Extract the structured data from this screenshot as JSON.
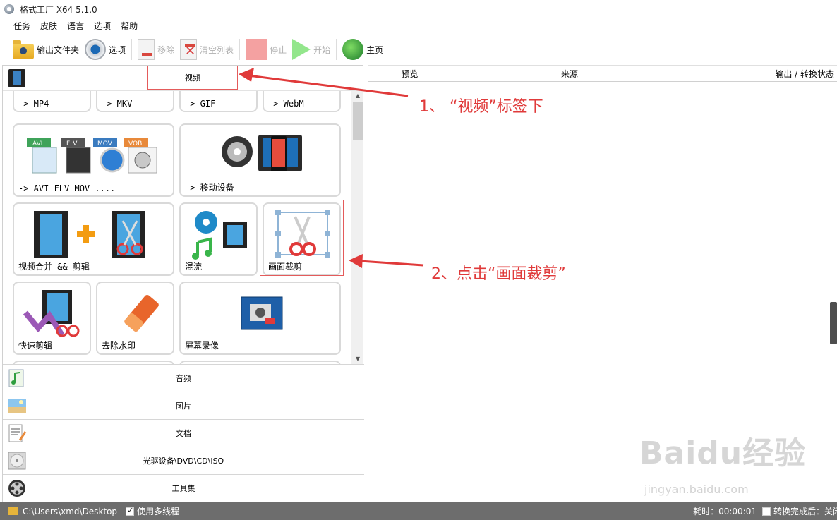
{
  "window": {
    "title": "格式工厂 X64 5.1.0"
  },
  "menu": [
    "任务",
    "皮肤",
    "语言",
    "选项",
    "帮助"
  ],
  "toolbar": {
    "output_folder": "输出文件夹",
    "options": "选项",
    "remove": "移除",
    "clear_list": "清空列表",
    "stop": "停止",
    "start": "开始",
    "home": "主页"
  },
  "left_panel": {
    "active_category": "视频",
    "tiles_top_row": [
      "-> MP4",
      "-> MKV",
      "-> GIF",
      "-> WebM"
    ],
    "tile_avi": "-> AVI FLV MOV ....",
    "avi_badges": [
      "AVI",
      "FLV",
      "MOV",
      "VOB"
    ],
    "tile_mobile": "-> 移动设备",
    "tile_merge": "视频合并 && 剪辑",
    "tile_mux": "混流",
    "tile_crop": "画面裁剪",
    "tile_quickcut": "快速剪辑",
    "tile_watermark": "去除水印",
    "tile_screenrec": "屏幕录像",
    "categories": [
      "音频",
      "图片",
      "文档",
      "光驱设备\\DVD\\CD\\ISO",
      "工具集"
    ]
  },
  "right_panel": {
    "columns": [
      "预览",
      "来源",
      "输出 / 转换状态"
    ]
  },
  "statusbar": {
    "path": "C:\\Users\\xmd\\Desktop",
    "multithread": "使用多线程",
    "elapsed": "耗时：00:00:01",
    "after_done": "转换完成后：关闭"
  },
  "annotations": {
    "step1": "1、 “视频”标签下",
    "step2": "2、点击“画面裁剪”"
  },
  "watermark": {
    "brand": "Baidu经验",
    "url": "jingyan.baidu.com"
  },
  "colors": {
    "annotation": "#e03a3a",
    "statusbar": "#6d6d6d"
  }
}
